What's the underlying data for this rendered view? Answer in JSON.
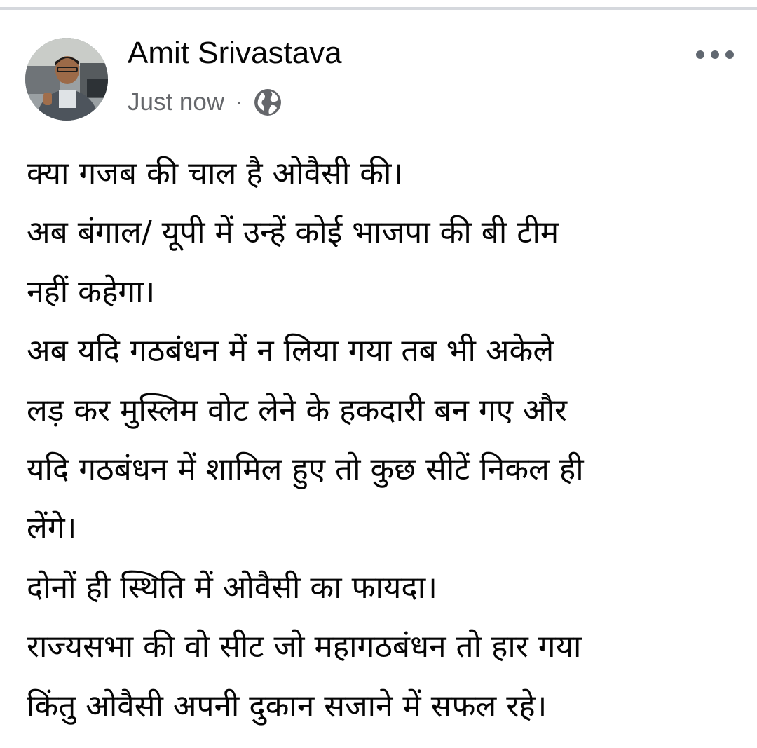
{
  "post": {
    "author": "Amit Srivastava",
    "timestamp": "Just now",
    "separator": "·",
    "privacy_icon": "globe-icon",
    "menu_icon": "more-horizontal-icon",
    "lines": [
      "क्या गजब की चाल है ओवैसी की।",
      "अब बंगाल/ यूपी में उन्हें कोई भाजपा की बी टीम",
      "नहीं कहेगा।",
      "अब यदि गठबंधन में न लिया गया तब भी अकेले",
      "लड़ कर मुस्लिम वोट लेने के हकदारी बन गए और",
      "यदि गठबंधन में शामिल हुए तो कुछ सीटें निकल ही",
      "लेंगे।",
      "दोनों ही स्थिति में ओवैसी का फायदा।",
      "राज्यसभा की वो सीट जो महागठबंधन तो हार गया",
      "किंतु ओवैसी अपनी दुकान सजाने में सफल रहे।"
    ]
  },
  "colors": {
    "text": "#050505",
    "secondary_text": "#65676b",
    "icon": "#606770",
    "top_bar_border": "#d5d8dd"
  }
}
